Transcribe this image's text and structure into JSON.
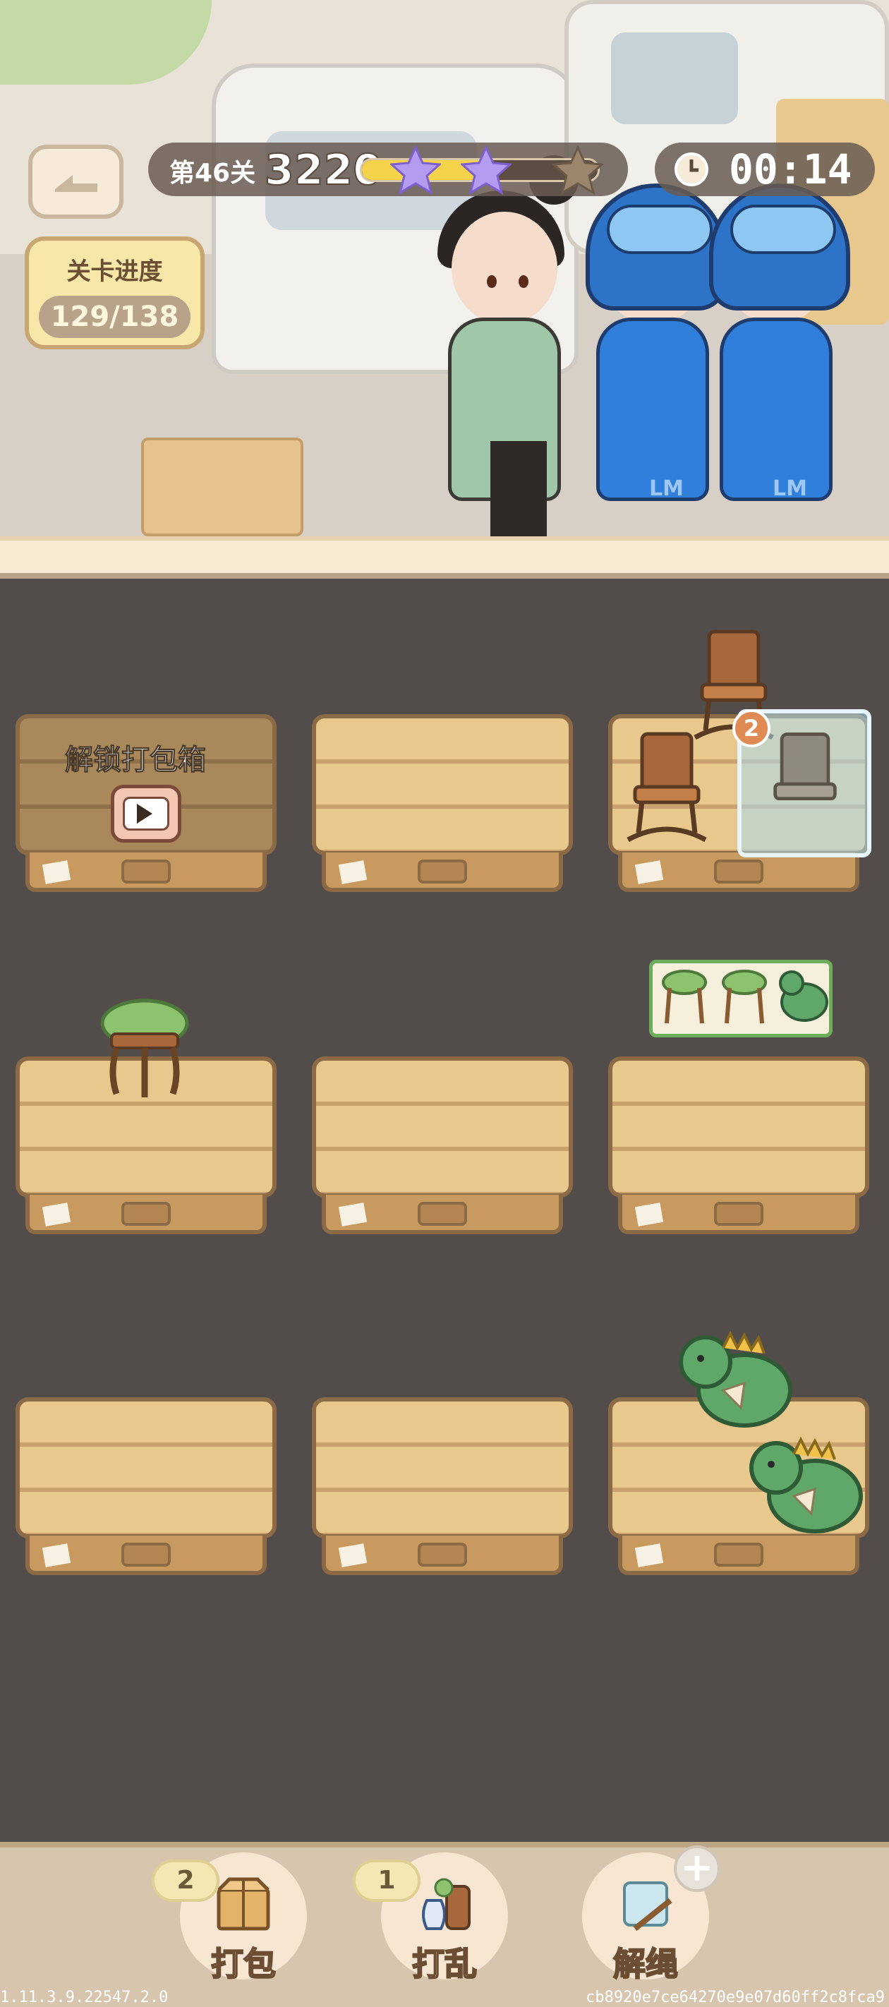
{
  "hud": {
    "level_label": "第46关",
    "score": "3220",
    "score_progress_fraction": 0.55,
    "stars_earned": 2,
    "stars_total": 3,
    "timer": "00:14"
  },
  "level_progress": {
    "title": "关卡进度",
    "value": "129/138"
  },
  "board": {
    "locked_slot_label": "解锁打包箱",
    "glass_badge_count": "2"
  },
  "toolbar": {
    "pack": {
      "label": "打包",
      "count": "2"
    },
    "shuffle": {
      "label": "打乱",
      "count": "1"
    },
    "untie": {
      "label": "解绳"
    }
  },
  "footer": {
    "version": "1.11.3.9.22547.2.0",
    "hash": "cb8920e7ce64270e9e07d60ff2c8fca9"
  },
  "colors": {
    "wood": "#e8c88c",
    "wood_border": "#8c6a45",
    "board_bg": "#524d4a",
    "courier_blue": "#2f7fdb",
    "timer_bg": "#695c52"
  }
}
